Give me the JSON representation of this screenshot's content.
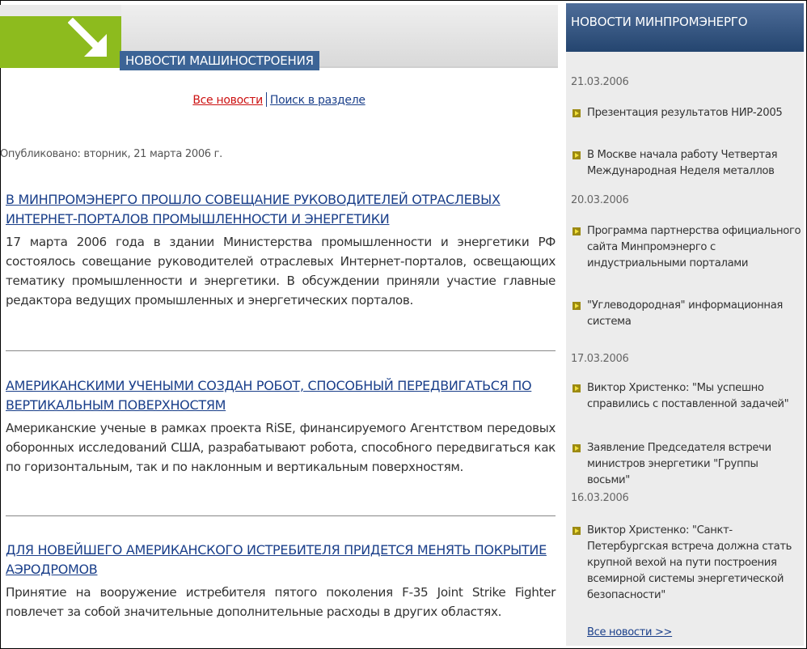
{
  "main": {
    "banner_title": "НОВОСТИ МАШИНОСТРОЕНИЯ",
    "links": {
      "all_news": "Все новости",
      "search_section": "Поиск в разделе"
    },
    "published": "Опубликовано: вторник, 21 марта 2006 г.",
    "articles": [
      {
        "title": "В МИНПРОМЭНЕРГО ПРОШЛО СОВЕЩАНИЕ РУКОВОДИТЕЛЕЙ ОТРАСЛЕВЫХ ИНТЕРНЕТ-ПОРТАЛОВ ПРОМЫШЛЕННОСТИ И ЭНЕРГЕТИКИ",
        "body": "17 марта 2006 года в здании Министерства промышленности и энергетики РФ состоялось совещание руководителей отраслевых Интернет-порталов, освещающих тематику промышленности и энергетики. В обсуждении приняли участие главные редактора ведущих промышленных и энергетических порталов."
      },
      {
        "title": "АМЕРИКАНСКИМИ УЧЕНЫМИ СОЗДАН РОБОТ, СПОСОБНЫЙ ПЕРЕДВИГАТЬСЯ ПО ВЕРТИКАЛЬНЫМ ПОВЕРХНОСТЯМ",
        "body": "Американские ученые в рамках проекта RiSE, финансируемого Агентством передовых оборонных исследований США, разрабатывают робота, способного передвигаться как по горизонтальным, так и по наклонным и вертикальным поверхностям."
      },
      {
        "title": "ДЛЯ НОВЕЙШЕГО АМЕРИКАНСКОГО ИСТРЕБИТЕЛЯ ПРИДЕТСЯ МЕНЯТЬ ПОКРЫТИЕ АЭРОДРОМОВ",
        "body": "Принятие на вооружение истребителя пятого поколения F-35 Joint Strike Fighter повлечет за собой значительные дополнительные расходы в других областях."
      }
    ]
  },
  "sidebar": {
    "title": "НОВОСТИ МИНПРОМЭНЕРГО",
    "groups": [
      {
        "date": "21.03.2006",
        "items": [
          "Презентация результатов НИР-2005",
          "В Москве начала работу Четвертая Международная Неделя металлов"
        ]
      },
      {
        "date": "20.03.2006",
        "items": [
          "Программа партнерства официального сайта Минпромэнерго с индустриальными порталами",
          "\"Углеводородная\" информационная система"
        ]
      },
      {
        "date": "17.03.2006",
        "items": [
          "Виктор Христенко: \"Мы успешно справились с поставленной задачей\"",
          "Заявление Председателя встречи министров энергетики \"Группы восьми\""
        ]
      },
      {
        "date": "16.03.2006",
        "items": [
          "Виктор Христенко: \"Санкт-Петербургская встреча должна стать крупной вехой на пути построения всемирной системы энергетической безопасности\""
        ]
      }
    ],
    "all_news": "Все новости >>"
  }
}
